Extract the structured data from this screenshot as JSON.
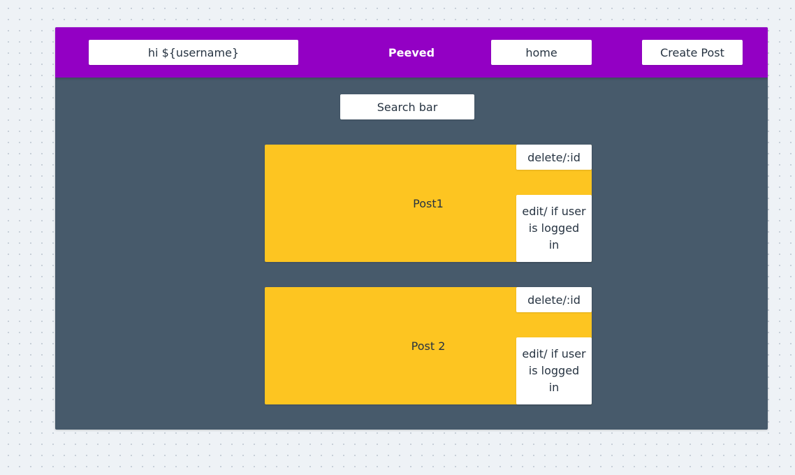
{
  "header": {
    "greeting": "hi ${username}",
    "brand": "Peeved",
    "home_label": "home",
    "create_post_label": "Create Post"
  },
  "search": {
    "label": "Search bar"
  },
  "posts": [
    {
      "title": "Post1",
      "delete_label": "delete/:id",
      "edit_label": "edit/ if user is logged in"
    },
    {
      "title": "Post 2",
      "delete_label": "delete/:id",
      "edit_label": "edit/ if user is logged in"
    }
  ],
  "colors": {
    "header": "#9300c4",
    "body": "#475a6b",
    "post": "#fdc521",
    "box": "#ffffff"
  }
}
